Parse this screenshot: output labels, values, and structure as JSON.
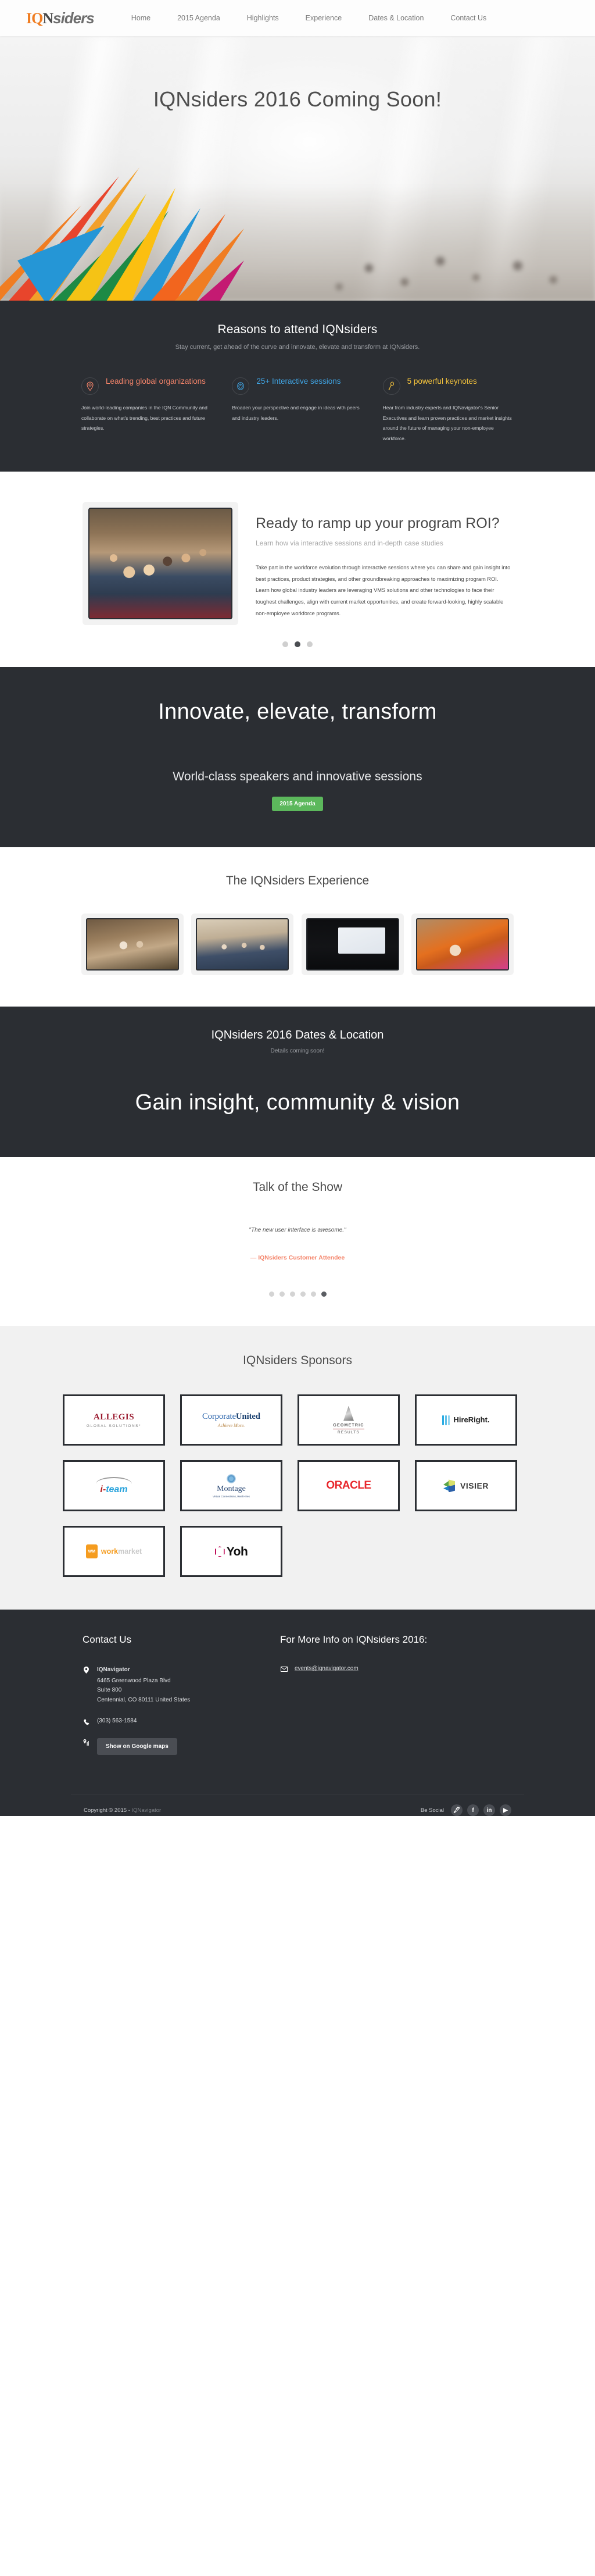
{
  "header": {
    "logo": {
      "iq": "IQ",
      "n": "N",
      "siders": "siders"
    },
    "nav": [
      {
        "label": "Home"
      },
      {
        "label": "2015 Agenda"
      },
      {
        "label": "Highlights"
      },
      {
        "label": "Experience"
      },
      {
        "label": "Dates & Location"
      },
      {
        "label": "Contact Us"
      }
    ]
  },
  "hero": {
    "title": "IQNsiders 2016 Coming Soon!"
  },
  "reasons": {
    "title": "Reasons to attend IQNsiders",
    "subtitle": "Stay current, get ahead of the curve and innovate, elevate and transform at IQNsiders.",
    "items": [
      {
        "icon": "map-pin-icon",
        "title": "Leading global organizations",
        "color": "#f4846a",
        "body": "Join world-leading companies in the IQN Community and collaborate on what's trending, best practices and future strategies."
      },
      {
        "icon": "target-icon",
        "title": "25+ Interactive sessions",
        "color": "#3fa2e0",
        "body": "Broaden your perspective and engage in ideas with peers and industry leaders."
      },
      {
        "icon": "microphone-icon",
        "title": "5 powerful keynotes",
        "color": "#f2c13c",
        "body": "Hear from industry experts and IQNavigator's Senior Executives and learn proven practices and market insights around the future of managing your non-employee workforce."
      }
    ]
  },
  "roi": {
    "heading": "Ready to ramp up your program ROI?",
    "lead": "Learn how via interactive sessions and in-depth case studies",
    "body": "Take part in the workforce evolution through interactive sessions where you can share and gain insight into best practices, product strategies, and other groundbreaking approaches to maximizing program ROI. Learn how global industry leaders are leveraging VMS solutions and other technologies to face their toughest challenges, align with current market opportunities, and create forward-looking, highly scalable non-employee workforce programs.",
    "carousel": {
      "total": 3,
      "active_index": 1
    }
  },
  "highlights": {
    "big": "Innovate, elevate, transform",
    "mid": "World-class speakers and innovative sessions",
    "button": "2015 Agenda"
  },
  "experience": {
    "title": "The IQNsiders Experience",
    "photos": [
      {
        "alt": "attendees-celebrating-photo"
      },
      {
        "alt": "conference-audience-photo"
      },
      {
        "alt": "keynote-speaker-photo"
      },
      {
        "alt": "attendee-portrait-photo"
      }
    ]
  },
  "dates": {
    "title": "IQNsiders 2016 Dates & Location",
    "subtitle": "Details coming soon!",
    "big": "Gain insight, community & vision"
  },
  "talk": {
    "title": "Talk of the Show",
    "quote": "\"The new user interface is awesome.\"",
    "author": "— IQNsiders Customer Attendee",
    "carousel": {
      "total": 6,
      "active_index": 5
    }
  },
  "sponsors": {
    "title": "IQNsiders Sponsors",
    "items": [
      {
        "key": "allegis",
        "name": "ALLEGIS",
        "tagline": "GLOBAL SOLUTIONS*"
      },
      {
        "key": "corporate-united",
        "name_light": "Corporate",
        "name_bold": "United",
        "tagline": "Achieve More."
      },
      {
        "key": "geometric-results",
        "name": "GEOMETRIC",
        "tagline": "RESULTS"
      },
      {
        "key": "hireright",
        "name": "HireRight."
      },
      {
        "key": "i-team",
        "name_a": "i-",
        "name_b": "team"
      },
      {
        "key": "montage",
        "name": "Montage",
        "tagline": "Virtual Connections, Real Hires"
      },
      {
        "key": "oracle",
        "name": "ORACLE"
      },
      {
        "key": "visier",
        "name": "VISIER"
      },
      {
        "key": "work-market",
        "mark": "WM",
        "name_a": "work",
        "name_b": "market"
      },
      {
        "key": "yoh",
        "name": "Yoh"
      }
    ]
  },
  "footer": {
    "contact_title": "Contact Us",
    "more_info_title": "For More Info on IQNsiders 2016:",
    "company": "IQNavigator",
    "address": "6465 Greenwood Plaza Blvd\nSuite 800\nCentennial, CO 80111 United States",
    "phone": "(303) 563-1584",
    "maps_button": "Show on Google maps",
    "email": "events@iqnavigator.com",
    "copyright_prefix": "Copyright © 2015 - ",
    "copyright_company": "IQNavigator",
    "social_label": "Be Social",
    "social": [
      {
        "name": "twitter",
        "glyph": "🖋"
      },
      {
        "name": "facebook",
        "glyph": "f"
      },
      {
        "name": "linkedin",
        "glyph": "in"
      },
      {
        "name": "youtube",
        "glyph": "▶"
      }
    ]
  }
}
